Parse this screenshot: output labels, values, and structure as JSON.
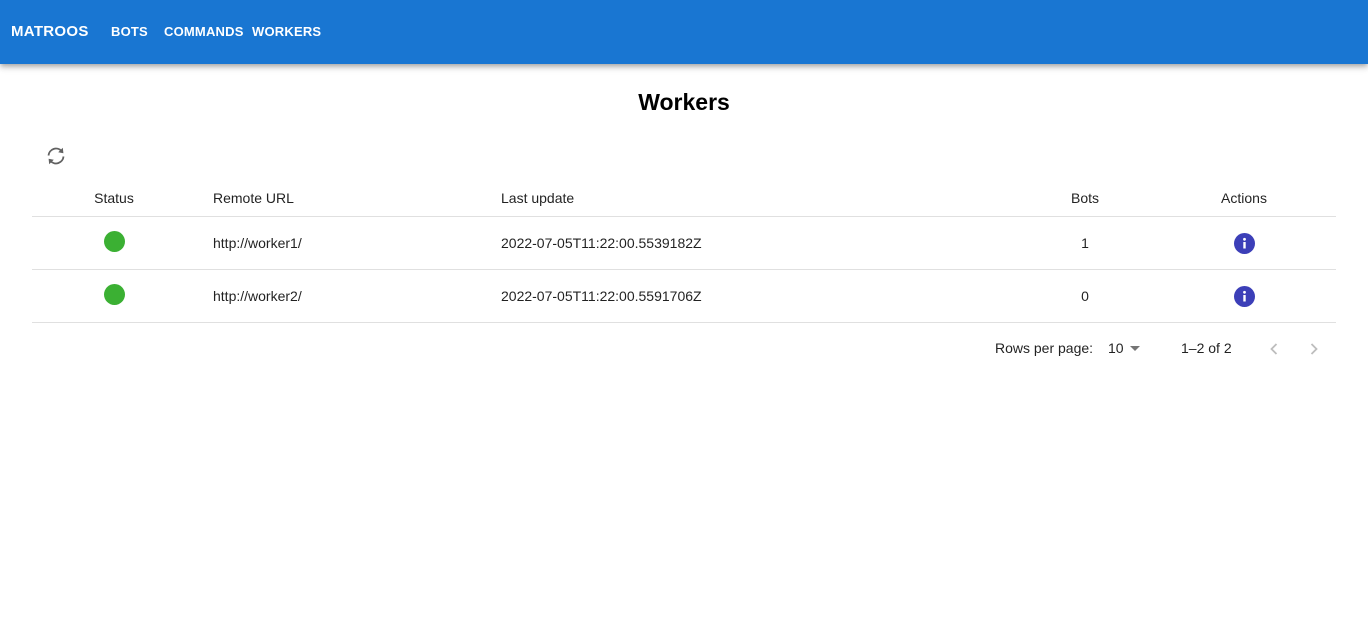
{
  "appbar": {
    "brand": "MATROOS",
    "nav": [
      {
        "label": "BOTS"
      },
      {
        "label": "COMMANDS"
      },
      {
        "label": "WORKERS"
      }
    ],
    "color": "#1976d2"
  },
  "page": {
    "title": "Workers"
  },
  "toolbar": {
    "refresh_icon": "refresh-icon"
  },
  "table": {
    "headers": {
      "status": "Status",
      "remote_url": "Remote URL",
      "last_update": "Last update",
      "bots": "Bots",
      "actions": "Actions"
    },
    "rows": [
      {
        "status": "online",
        "status_color": "#3bb033",
        "remote_url": "http://worker1/",
        "last_update": "2022-07-05T11:22:00.5539182Z",
        "bots": "1",
        "action_icon": "info-icon"
      },
      {
        "status": "online",
        "status_color": "#3bb033",
        "remote_url": "http://worker2/",
        "last_update": "2022-07-05T11:22:00.5591706Z",
        "bots": "0",
        "action_icon": "info-icon"
      }
    ]
  },
  "pagination": {
    "rows_per_page_label": "Rows per page:",
    "rows_per_page_value": "10",
    "range": "1–2 of 2"
  }
}
